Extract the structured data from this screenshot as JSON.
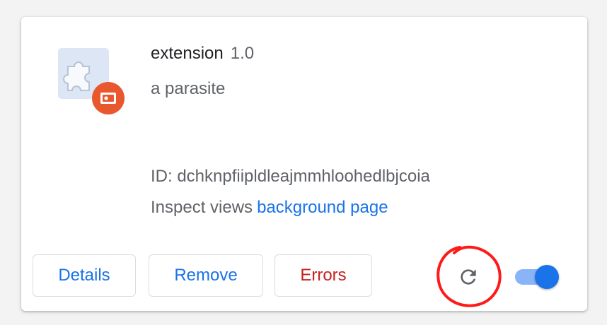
{
  "extension": {
    "name": "extension",
    "version": "1.0",
    "description": "a parasite",
    "id_text": "ID: dchknpfiipldleajmmhloohedlbjcoia",
    "inspect_label": "Inspect views",
    "inspect_link": "background page",
    "enabled": true
  },
  "buttons": {
    "details": "Details",
    "remove": "Remove",
    "errors": "Errors"
  },
  "icons": {
    "extension": "puzzle-piece-icon",
    "badge": "policy-badge-icon",
    "reload": "reload-icon"
  },
  "colors": {
    "link": "#1a73e8",
    "errors": "#c5221f",
    "badge": "#e8572e",
    "toggle_on": "#1a73e8",
    "annotation": "#ff0000"
  }
}
